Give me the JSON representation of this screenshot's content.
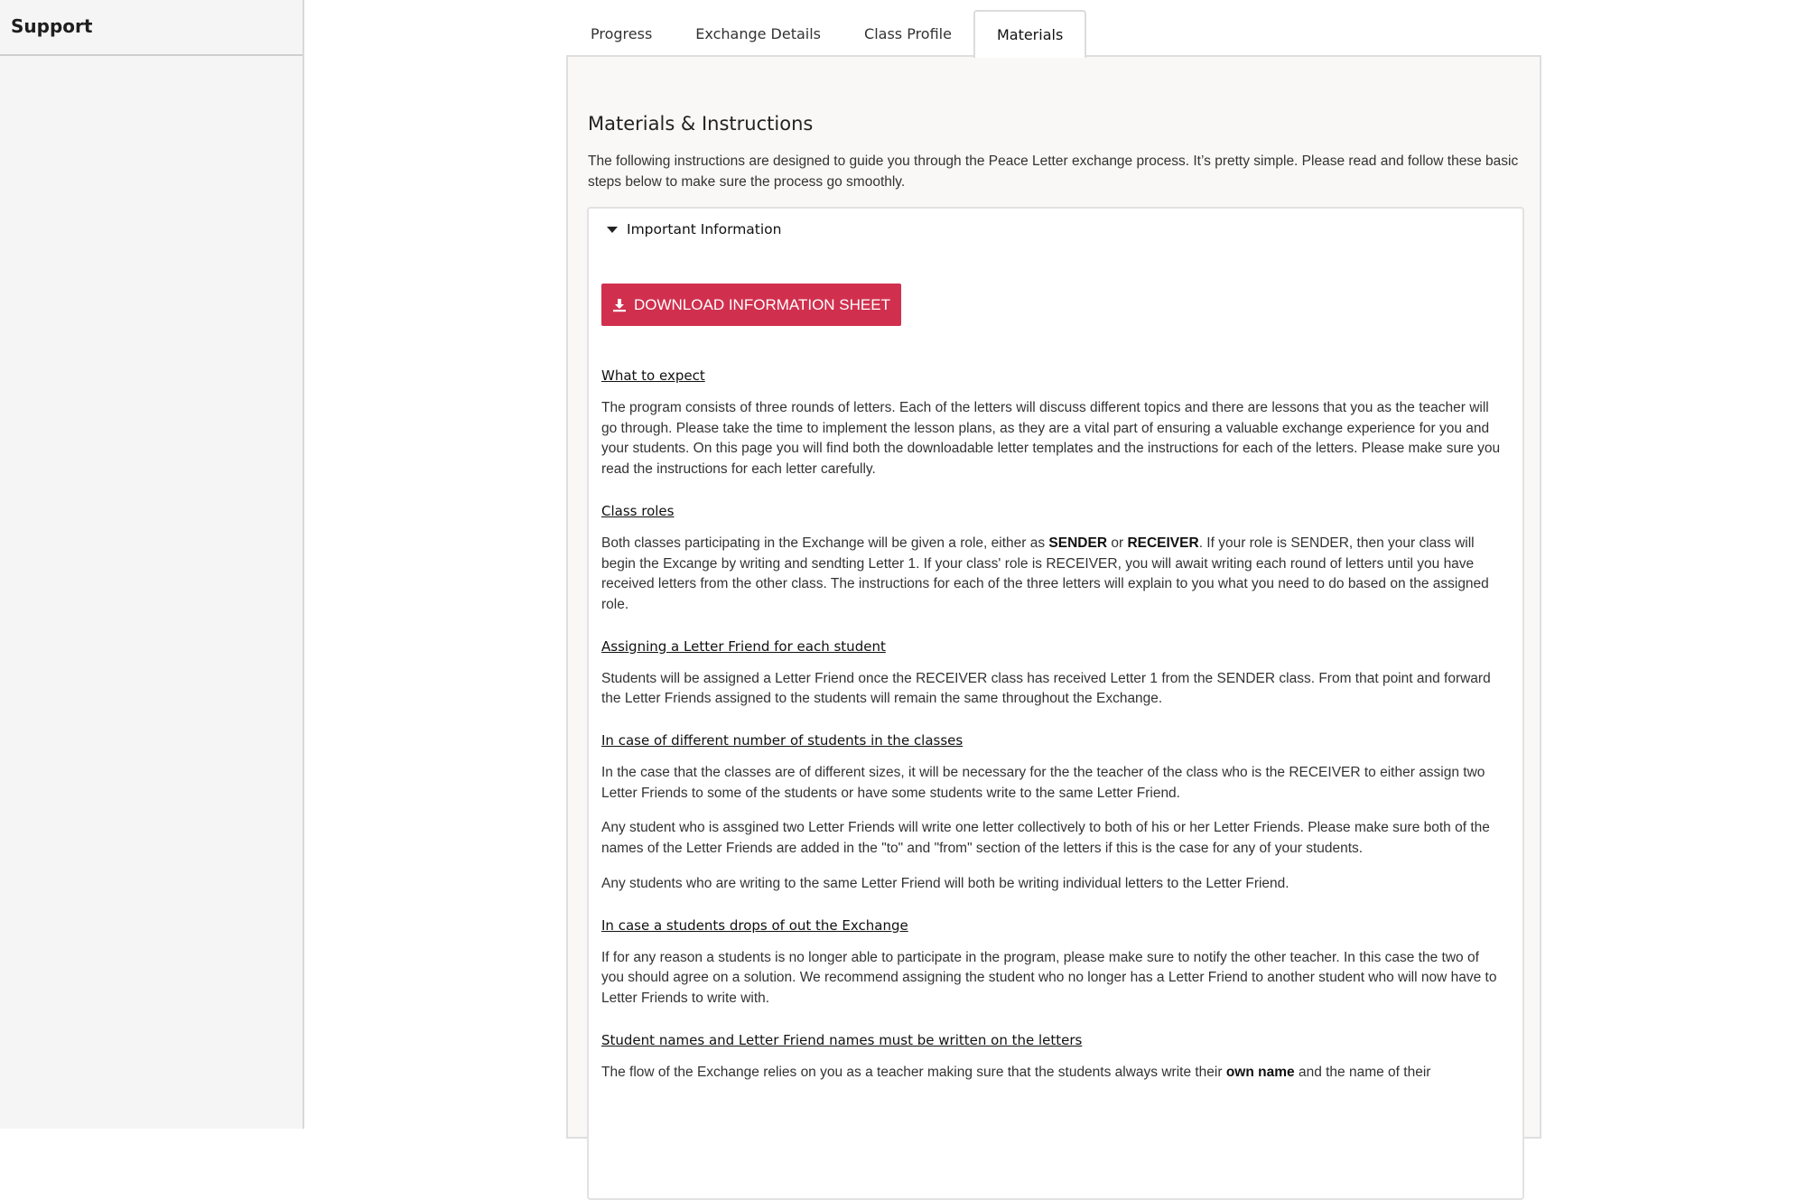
{
  "sidebar": {
    "title": "Support"
  },
  "tabs": [
    {
      "label": "Progress"
    },
    {
      "label": "Exchange Details"
    },
    {
      "label": "Class Profile"
    },
    {
      "label": "Materials",
      "active": true
    }
  ],
  "main": {
    "title": "Materials & Instructions",
    "intro": "The following instructions are designed to guide you through the Peace Letter exchange process. It’s pretty simple. Please read and follow these basic steps below to make sure the process go smoothly.",
    "important": {
      "summary": "Important Information",
      "download_label": "DOWNLOAD INFORMATION SHEET",
      "download_icon": "download-icon",
      "button_color": "#d0304e"
    },
    "sections": [
      {
        "heading": "What to expect",
        "p1": "The program consists of three rounds of letters. Each of the letters will discuss different topics and there are lessons that you as the teacher will go through. Please take the time to implement the lesson plans, as they are a vital part of ensuring a valuable exchange experience for you and your students. On this page you will find both the downloadable letter templates and the instructions for each of the letters. Please make sure you read the instructions for each letter carefully."
      },
      {
        "heading": "Class roles",
        "p1_a": "Both classes participating in the Exchange will be given a role, either as ",
        "p1_b": "SENDER",
        "p1_c": " or ",
        "p1_d": "RECEIVER",
        "p1_e": ". If your role is SENDER, then your class will begin the Excange by writing and sendting Letter 1. If your class' role is RECEIVER, you will await writing each round of letters until you have received letters from the other class. The instructions for each of the three letters will explain to you what you need to do based on the assigned role."
      },
      {
        "heading": "Assigning a Letter Friend for each student",
        "p1": "Students will be assigned a Letter Friend once the RECEIVER class has received Letter 1 from the SENDER class. From that point and forward the Letter Friends assigned to the students will remain the same throughout the Exchange."
      },
      {
        "heading": "In case of different number of students in the classes",
        "p1": "In the case that the classes are of different sizes, it will be necessary for the the teacher of the class who is the RECEIVER to either assign two Letter Friends to some of the students or have some students write to the same Letter Friend.",
        "p2": "Any student who is assgined two Letter Friends will write one letter collectively to both of his or her Letter Friends. Please make sure both of the names of the Letter Friends are added in the \"to\" and \"from\" section of the letters if this is the case for any of your students.",
        "p3": "Any students who are writing to the same Letter Friend will both be writing individual letters to the Letter Friend."
      },
      {
        "heading": "In case a students drops of out the Exchange",
        "p1": "If for any reason a students is no longer able to participate in the program, please make sure to notify the other teacher. In this case the two of you should agree on a solution. We recommend assigning the student who no longer has a Letter Friend to another student who will now have to Letter Friends to write with."
      },
      {
        "heading": "Student names and Letter Friend names must be written on the letters",
        "p1_a": "The flow of the Exchange relies on you as a teacher making sure that the students always write their ",
        "p1_b": "own name",
        "p1_c": " and the name of their"
      }
    ]
  }
}
